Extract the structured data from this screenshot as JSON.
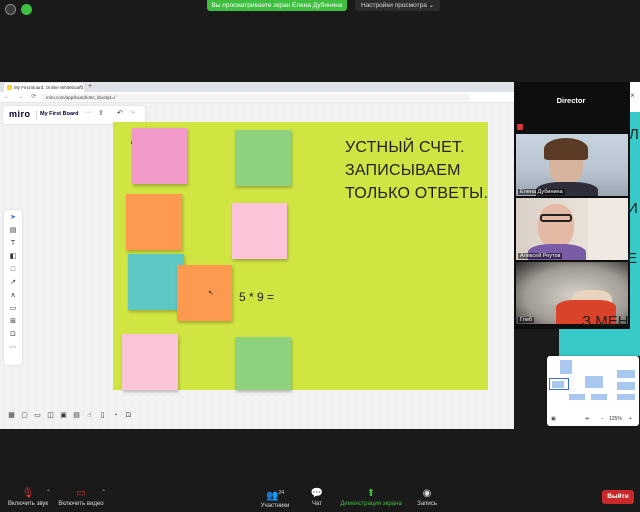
{
  "zoom_top": {
    "share_banner": "Вы просматриваете экран Елена Дубинина",
    "view_options": "Настройки просмотра ⌄"
  },
  "browser": {
    "tab_title": "My First Board, Online Whiteboard",
    "url": "miro.com/app/board/o9J_lduo5j4=/"
  },
  "miro": {
    "logo": "miro",
    "board_name": "My First Board",
    "frame_text": "УСТНЫЙ СЧЕТ. ЗАПИСЫВАЕМ ТОЛЬКО ОТВЕТЫ.",
    "expression": "5 * 9 =",
    "dash": "/",
    "zoom_level": "125%",
    "sticky_colors": {
      "pink": "#f19ac9",
      "green": "#8ed17e",
      "orange": "#fd9a50",
      "light_pink": "#fbc4d9",
      "teal": "#5ec8c5",
      "frame": "#d0e442"
    }
  },
  "participants": {
    "title": "Director",
    "videos": [
      {
        "name": "Елена Дубинина"
      },
      {
        "name": "Алексей Реутов"
      },
      {
        "name": "Глеб"
      }
    ]
  },
  "background_letters": [
    "Л",
    "И",
    "Е",
    "З МЕН"
  ],
  "zoom_bottom": {
    "mute_label": "Включить звук",
    "video_label": "Включить видео",
    "participants_label": "Участники",
    "participants_count": "24",
    "chat_label": "Чат",
    "share_label": "Демонстрация экрана",
    "record_label": "Запись",
    "leave_label": "Выйти"
  }
}
